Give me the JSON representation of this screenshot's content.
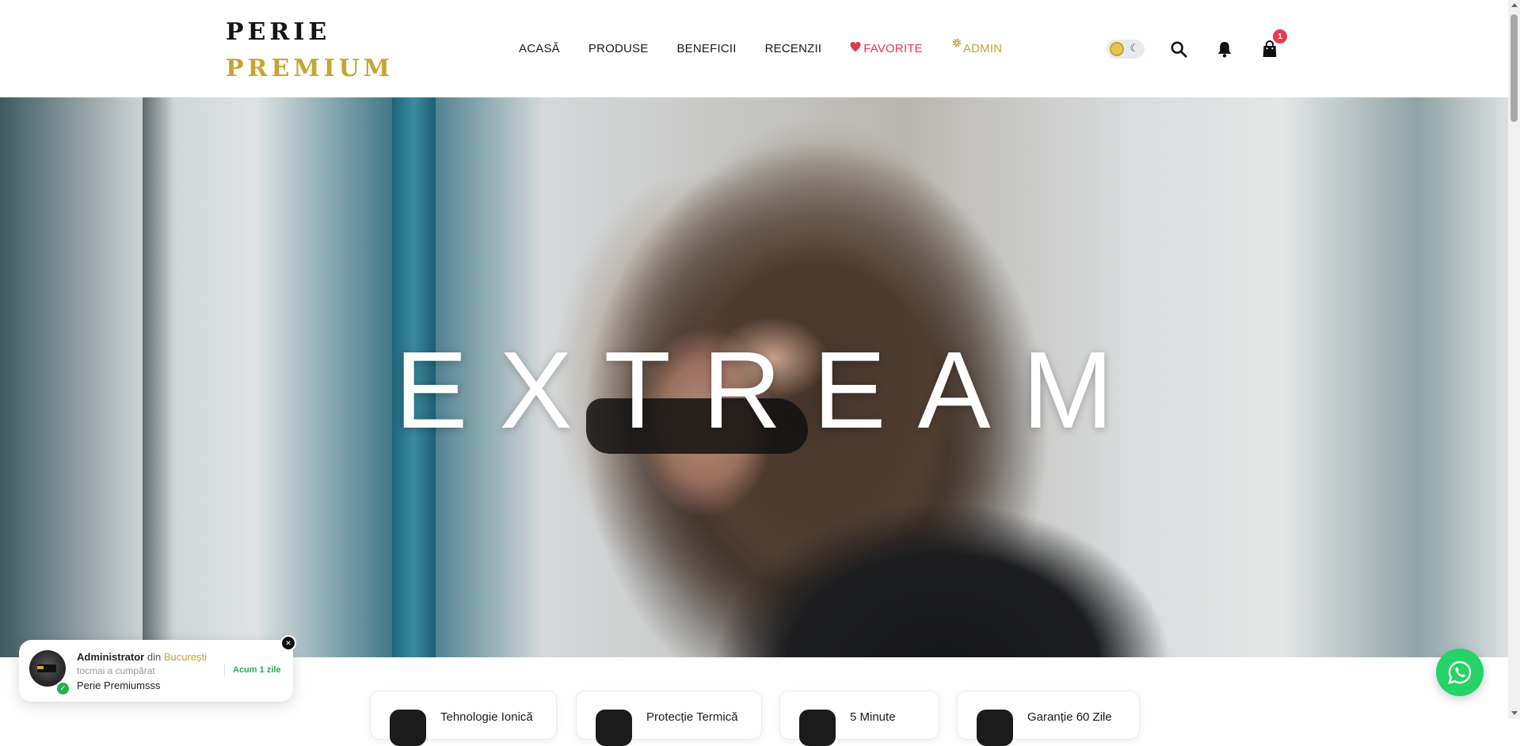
{
  "brand": {
    "line1": "PERIE",
    "line2": "PREMIUM",
    "colors": {
      "dark": "#141414",
      "gold": "#c9a431"
    }
  },
  "nav": {
    "items": [
      {
        "label": "ACASĂ"
      },
      {
        "label": "PRODUSE"
      },
      {
        "label": "BENEFICII"
      },
      {
        "label": "RECENZII"
      },
      {
        "label": "FAVORITE",
        "icon": "heart-icon",
        "color": "#e53a4c"
      },
      {
        "label": "ADMIN",
        "icon": "gear-icon",
        "color": "#c9a431"
      }
    ]
  },
  "header_actions": {
    "theme_toggle": {
      "icons": [
        "sun-icon",
        "moon-icon"
      ],
      "state": "light"
    },
    "search_icon": "search-icon",
    "notifications_icon": "bell-icon",
    "cart_icon": "shopping-bag-icon",
    "cart_count": "1",
    "badge_color": "#e53a4c"
  },
  "hero": {
    "title": "EXTREAM"
  },
  "features": [
    {
      "label": "Tehnologie Ionică",
      "icon": "ion-icon"
    },
    {
      "label": "Protecție Termică",
      "icon": "thermal-icon"
    },
    {
      "label": "5 Minute",
      "icon": "clock-icon"
    },
    {
      "label": "Garanție 60 Zile",
      "icon": "shield-icon"
    }
  ],
  "purchase_popup": {
    "name": "Administrator",
    "from_word": "din",
    "city": "București",
    "action": "tocmai a cumpărat",
    "product": "Perie Premiumsss",
    "time_ago": "Acum 1 zile",
    "icons": [
      "product-thumbnail",
      "check-icon",
      "close-icon"
    ]
  },
  "whatsapp": {
    "icon": "whatsapp-icon",
    "color": "#25d366"
  }
}
